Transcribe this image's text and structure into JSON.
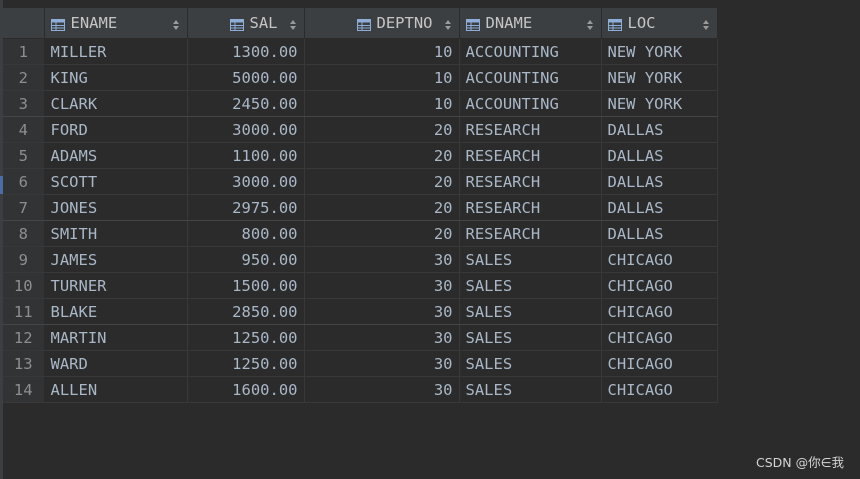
{
  "columns": [
    {
      "name": "ENAME",
      "icon": "table-column-icon"
    },
    {
      "name": "SAL",
      "icon": "table-column-icon"
    },
    {
      "name": "DEPTNO",
      "icon": "table-column-icon"
    },
    {
      "name": "DNAME",
      "icon": "table-column-icon"
    },
    {
      "name": "LOC",
      "icon": "table-column-icon"
    }
  ],
  "rows": [
    {
      "num": "1",
      "ename": "MILLER",
      "sal": "1300.00",
      "deptno": "10",
      "dname": "ACCOUNTING",
      "loc": "NEW YORK"
    },
    {
      "num": "2",
      "ename": "KING",
      "sal": "5000.00",
      "deptno": "10",
      "dname": "ACCOUNTING",
      "loc": "NEW YORK"
    },
    {
      "num": "3",
      "ename": "CLARK",
      "sal": "2450.00",
      "deptno": "10",
      "dname": "ACCOUNTING",
      "loc": "NEW YORK"
    },
    {
      "num": "4",
      "ename": "FORD",
      "sal": "3000.00",
      "deptno": "20",
      "dname": "RESEARCH",
      "loc": "DALLAS"
    },
    {
      "num": "5",
      "ename": "ADAMS",
      "sal": "1100.00",
      "deptno": "20",
      "dname": "RESEARCH",
      "loc": "DALLAS"
    },
    {
      "num": "6",
      "ename": "SCOTT",
      "sal": "3000.00",
      "deptno": "20",
      "dname": "RESEARCH",
      "loc": "DALLAS"
    },
    {
      "num": "7",
      "ename": "JONES",
      "sal": "2975.00",
      "deptno": "20",
      "dname": "RESEARCH",
      "loc": "DALLAS"
    },
    {
      "num": "8",
      "ename": "SMITH",
      "sal": "800.00",
      "deptno": "20",
      "dname": "RESEARCH",
      "loc": "DALLAS"
    },
    {
      "num": "9",
      "ename": "JAMES",
      "sal": "950.00",
      "deptno": "30",
      "dname": "SALES",
      "loc": "CHICAGO"
    },
    {
      "num": "10",
      "ename": "TURNER",
      "sal": "1500.00",
      "deptno": "30",
      "dname": "SALES",
      "loc": "CHICAGO"
    },
    {
      "num": "11",
      "ename": "BLAKE",
      "sal": "2850.00",
      "deptno": "30",
      "dname": "SALES",
      "loc": "CHICAGO"
    },
    {
      "num": "12",
      "ename": "MARTIN",
      "sal": "1250.00",
      "deptno": "30",
      "dname": "SALES",
      "loc": "CHICAGO"
    },
    {
      "num": "13",
      "ename": "WARD",
      "sal": "1250.00",
      "deptno": "30",
      "dname": "SALES",
      "loc": "CHICAGO"
    },
    {
      "num": "14",
      "ename": "ALLEN",
      "sal": "1600.00",
      "deptno": "30",
      "dname": "SALES",
      "loc": "CHICAGO"
    }
  ],
  "watermark": "CSDN @你∈我",
  "colors": {
    "background": "#2b2b2b",
    "header_bg": "#3c3f41",
    "text": "#a9b7c6",
    "icon_blue": "#8eaed8"
  }
}
